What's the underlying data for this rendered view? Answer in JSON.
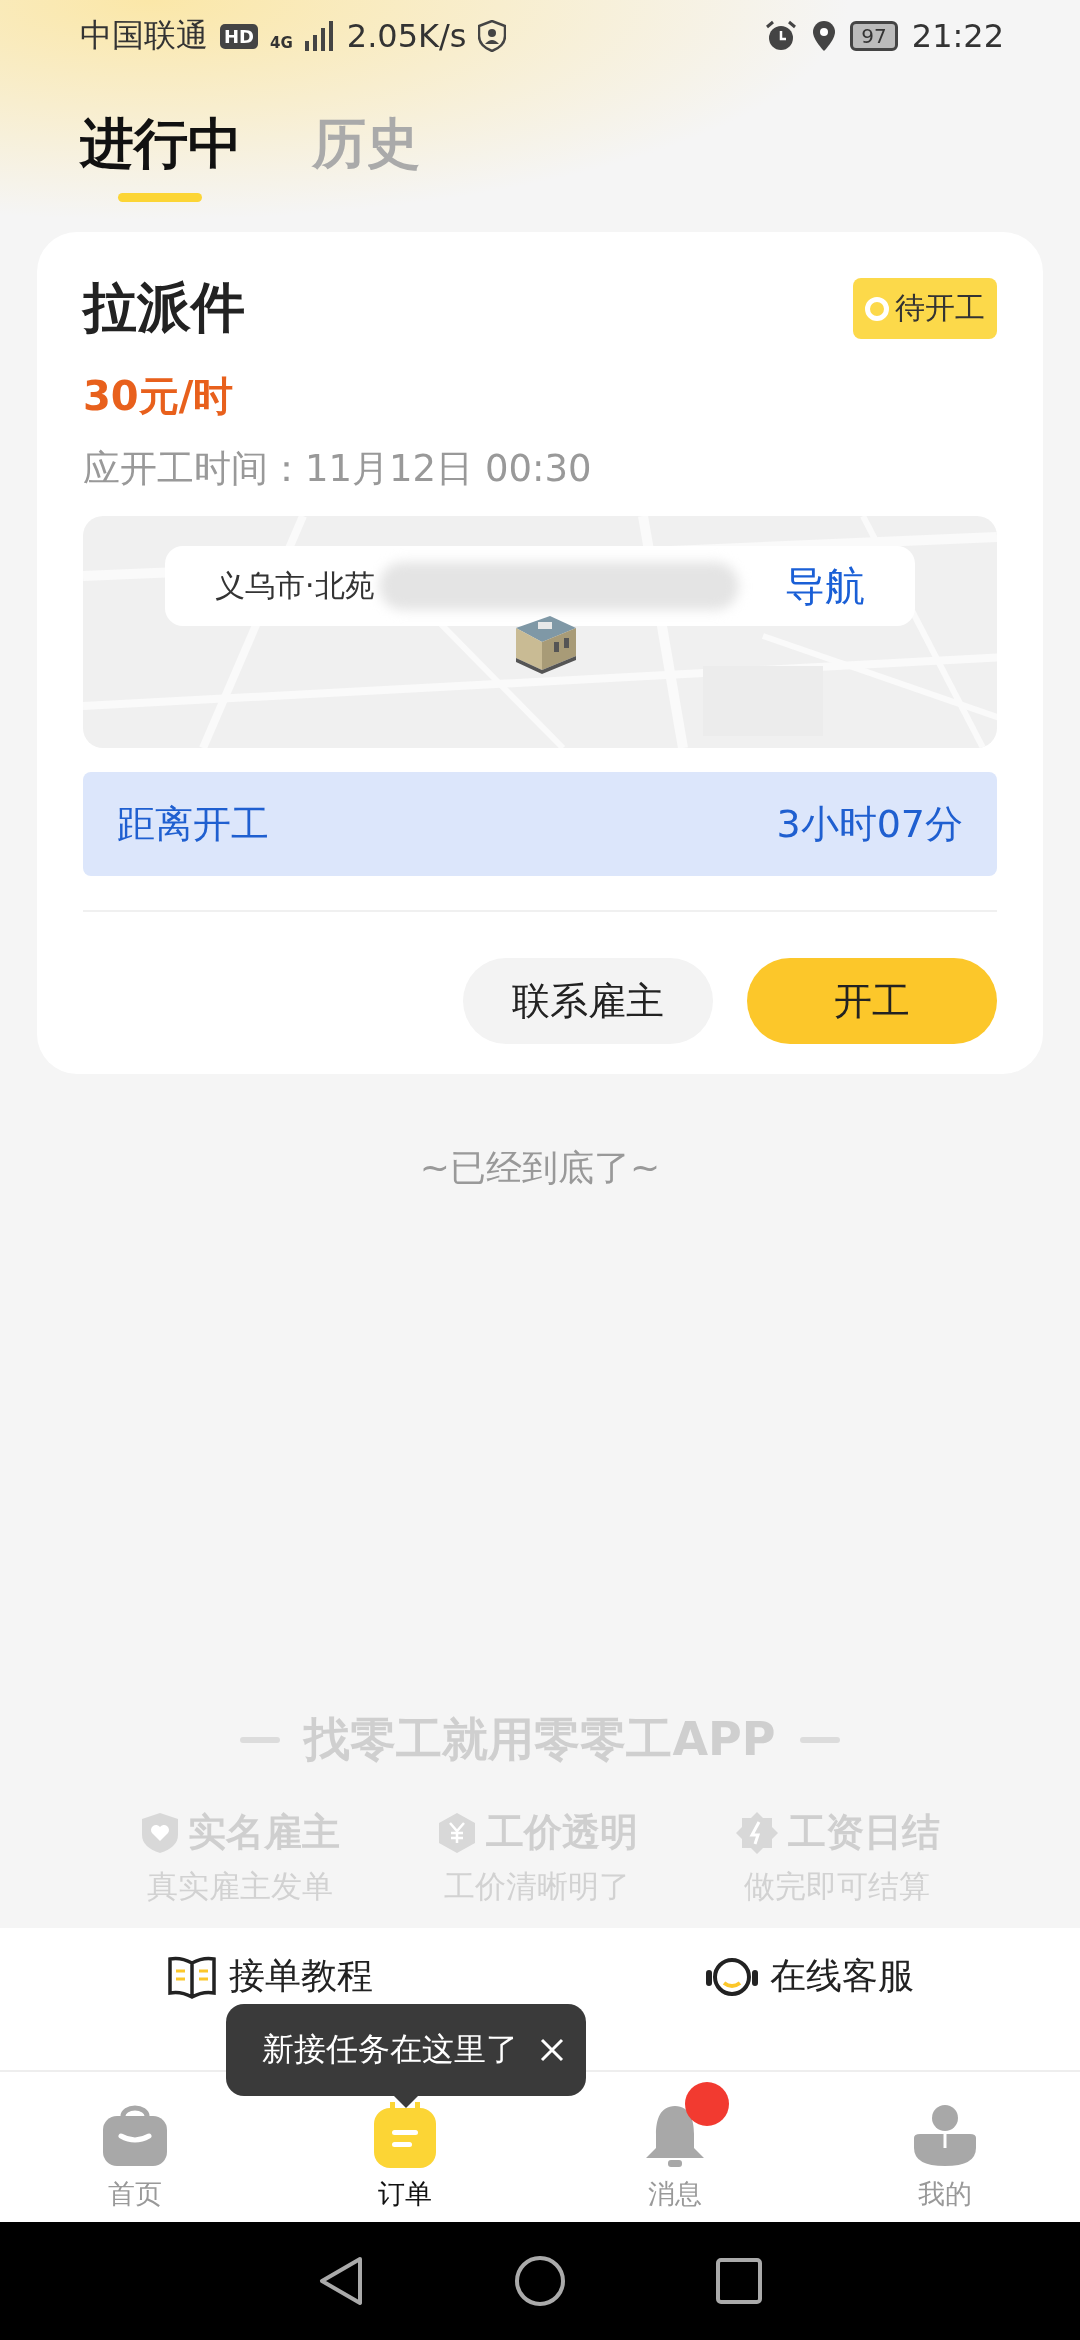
{
  "status_bar": {
    "carrier": "中国联通",
    "hd": "HD",
    "network": "4G",
    "speed": "2.05K/s",
    "battery": "97",
    "time": "21:22"
  },
  "tabs": [
    {
      "label": "进行中",
      "selected": true
    },
    {
      "label": "历史",
      "selected": false
    }
  ],
  "order": {
    "title": "拉派件",
    "status": "待开工",
    "pay": "30元/时",
    "start_time": "应开工时间：11月12日 00:30",
    "address": "义乌市·北苑",
    "navigate": "导航",
    "countdown_label": "距离开工",
    "countdown": "3小时07分",
    "buttons": [
      {
        "label": "联系雇主",
        "kind": "secondary"
      },
      {
        "label": "开工",
        "kind": "primary"
      }
    ]
  },
  "end_note": "~已经到底了~",
  "promo": {
    "slogan": "找零工就用零零工APP",
    "features": [
      {
        "title": "实名雇主",
        "subtitle": "真实雇主发单",
        "kind": "shield"
      },
      {
        "title": "工价透明",
        "subtitle": "工价清晰明了",
        "kind": "price"
      },
      {
        "title": "工资日结",
        "subtitle": "做完即可结算",
        "kind": "seal"
      }
    ]
  },
  "help_links": [
    {
      "label": "接单教程",
      "kind": "book"
    },
    {
      "label": "在线客服",
      "kind": "headset"
    }
  ],
  "tooltip": {
    "text": "新接任务在这里了"
  },
  "nav": [
    {
      "label": "首页",
      "kind": "home",
      "selected": false,
      "badge": false
    },
    {
      "label": "订单",
      "kind": "orders",
      "selected": true,
      "badge": false
    },
    {
      "label": "消息",
      "kind": "messages",
      "selected": false,
      "badge": true
    },
    {
      "label": "我的",
      "kind": "me",
      "selected": false,
      "badge": false
    }
  ]
}
